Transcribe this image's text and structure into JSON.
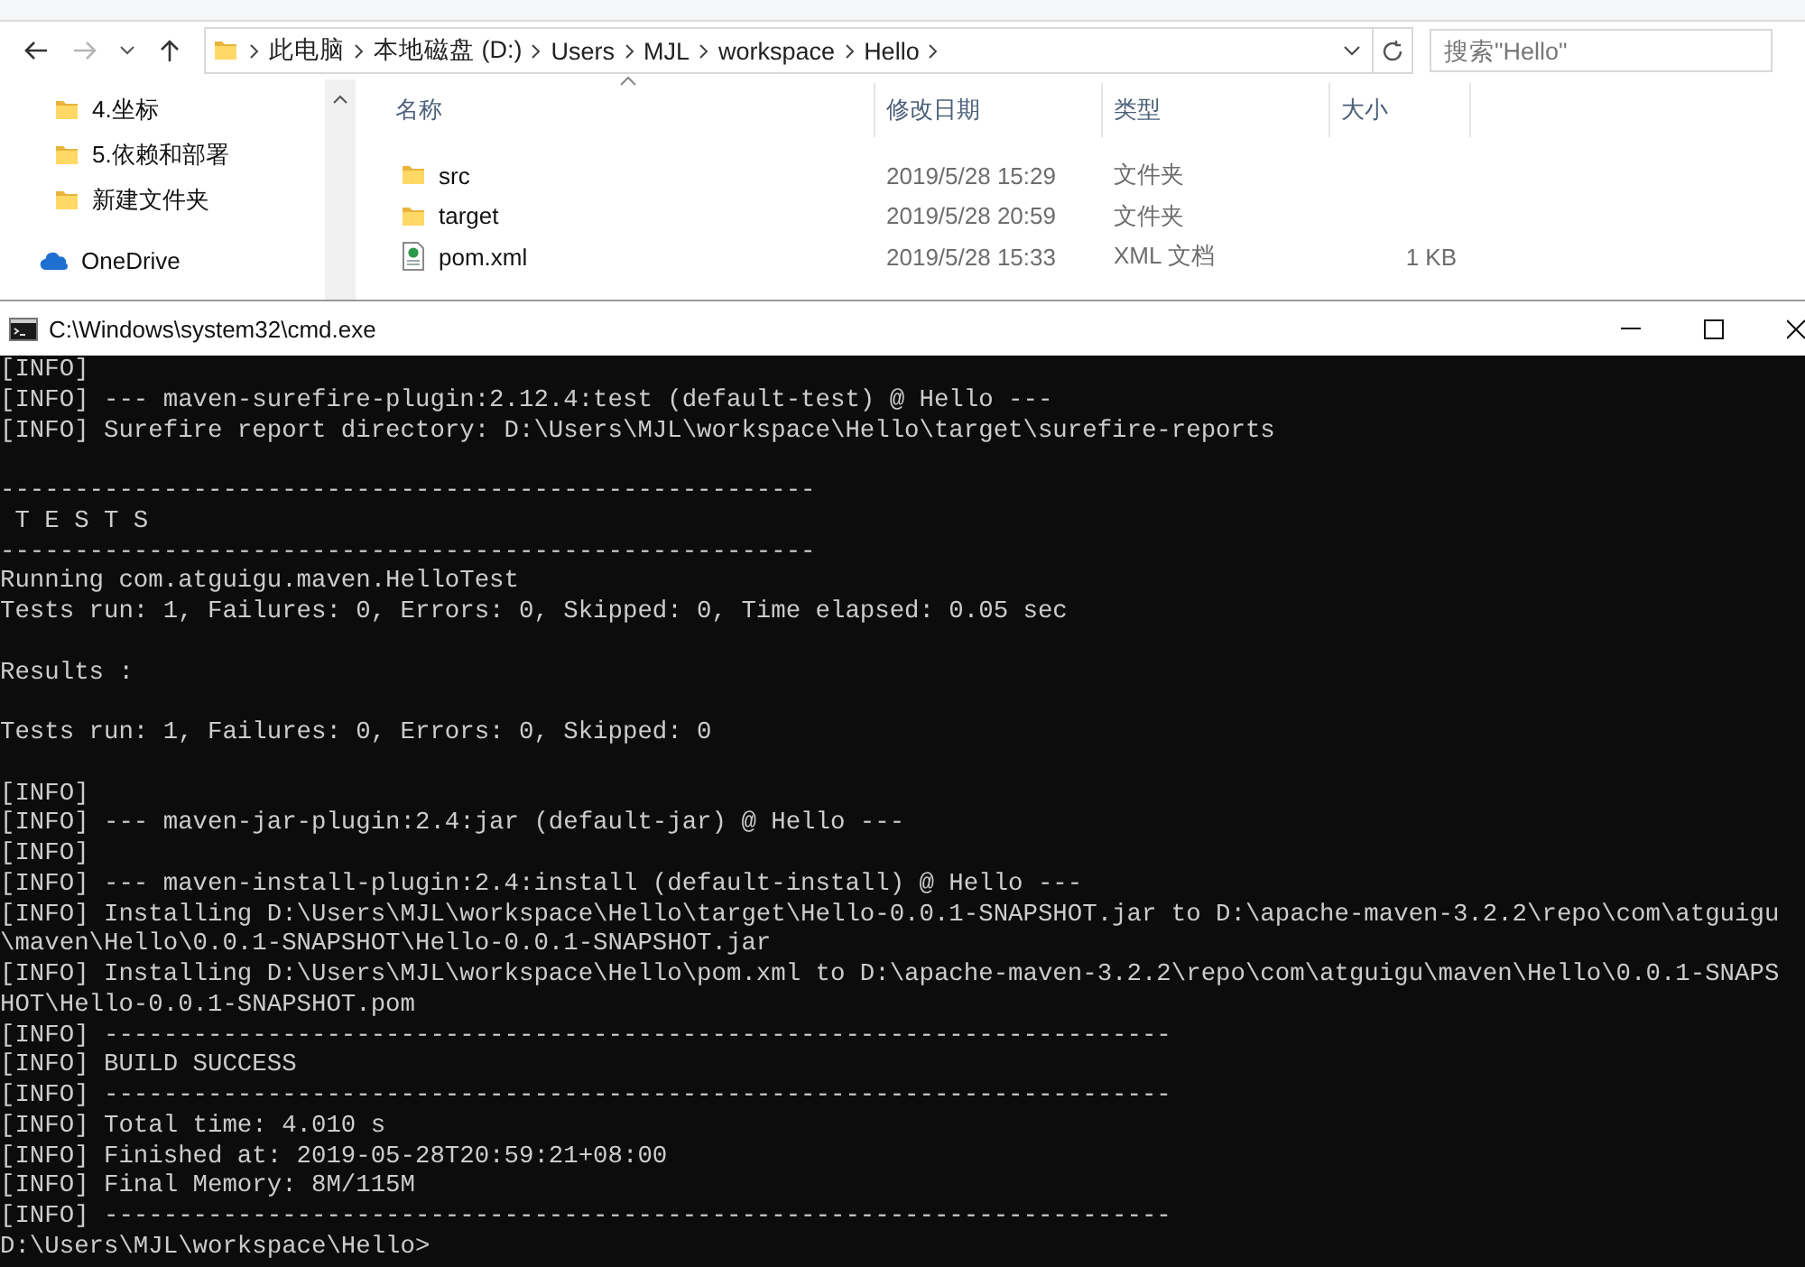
{
  "explorer": {
    "breadcrumbs": [
      "此电脑",
      "本地磁盘 (D:)",
      "Users",
      "MJL",
      "workspace",
      "Hello"
    ],
    "search": {
      "placeholder": "搜索\"Hello\""
    },
    "nav_pane": {
      "items": [
        {
          "kind": "folder",
          "label": "4.坐标"
        },
        {
          "kind": "folder",
          "label": "5.依赖和部署"
        },
        {
          "kind": "folder",
          "label": "新建文件夹"
        },
        {
          "kind": "cloud",
          "label": "OneDrive"
        }
      ]
    },
    "file_list": {
      "columns": [
        {
          "label": "名称",
          "sorted": true
        },
        {
          "label": "修改日期",
          "sorted": false
        },
        {
          "label": "类型",
          "sorted": false
        },
        {
          "label": "大小",
          "sorted": false
        }
      ],
      "rows": [
        {
          "kind": "folder",
          "name": "src",
          "modified": "2019/5/28 15:29",
          "type": "文件夹"
        },
        {
          "kind": "folder",
          "name": "target",
          "modified": "2019/5/28 20:59",
          "type": "文件夹"
        },
        {
          "kind": "xml",
          "name": "pom.xml",
          "modified": "2019/5/28 15:33",
          "type": "XML 文档",
          "size": "1 KB"
        }
      ]
    }
  },
  "cmd": {
    "title": "C:\\Windows\\system32\\cmd.exe",
    "lines": [
      {
        "kind": "text",
        "text": "[INFO]"
      },
      {
        "kind": "text",
        "text": "[INFO] --- maven-surefire-plugin:2.12.4:test (default-test) @ Hello ---"
      },
      {
        "kind": "text",
        "text": "[INFO] Surefire report directory: D:\\Users\\MJL\\workspace\\Hello\\target\\surefire-reports"
      },
      {
        "kind": "blank"
      },
      {
        "kind": "text",
        "text": "-------------------------------------------------------"
      },
      {
        "kind": "text",
        "text": " T E S T S"
      },
      {
        "kind": "text",
        "text": "-------------------------------------------------------"
      },
      {
        "kind": "text",
        "text": "Running com.atguigu.maven.HelloTest"
      },
      {
        "kind": "text",
        "text": "Tests run: 1, Failures: 0, Errors: 0, Skipped: 0, Time elapsed: 0.05 sec"
      },
      {
        "kind": "blank"
      },
      {
        "kind": "text",
        "text": "Results :"
      },
      {
        "kind": "blank"
      },
      {
        "kind": "text",
        "text": "Tests run: 1, Failures: 0, Errors: 0, Skipped: 0"
      },
      {
        "kind": "blank"
      },
      {
        "kind": "text",
        "text": "[INFO]"
      },
      {
        "kind": "text",
        "text": "[INFO] --- maven-jar-plugin:2.4:jar (default-jar) @ Hello ---"
      },
      {
        "kind": "text",
        "text": "[INFO]"
      },
      {
        "kind": "text",
        "text": "[INFO] --- maven-install-plugin:2.4:install (default-install) @ Hello ---"
      },
      {
        "kind": "text",
        "text": "[INFO] Installing D:\\Users\\MJL\\workspace\\Hello\\target\\Hello-0.0.1-SNAPSHOT.jar to D:\\apache-maven-3.2.2\\repo\\com\\atguigu"
      },
      {
        "kind": "text",
        "text": "\\maven\\Hello\\0.0.1-SNAPSHOT\\Hello-0.0.1-SNAPSHOT.jar"
      },
      {
        "kind": "text",
        "text": "[INFO] Installing D:\\Users\\MJL\\workspace\\Hello\\pom.xml to D:\\apache-maven-3.2.2\\repo\\com\\atguigu\\maven\\Hello\\0.0.1-SNAPS"
      },
      {
        "kind": "text",
        "text": "HOT\\Hello-0.0.1-SNAPSHOT.pom"
      },
      {
        "kind": "text",
        "text": "[INFO] ------------------------------------------------------------------------"
      },
      {
        "kind": "text",
        "text": "[INFO] BUILD SUCCESS"
      },
      {
        "kind": "text",
        "text": "[INFO] ------------------------------------------------------------------------"
      },
      {
        "kind": "text",
        "text": "[INFO] Total time: 4.010 s"
      },
      {
        "kind": "text",
        "text": "[INFO] Finished at: 2019-05-28T20:59:21+08:00"
      },
      {
        "kind": "text",
        "text": "[INFO] Final Memory: 8M/115M"
      },
      {
        "kind": "text",
        "text": "[INFO] ------------------------------------------------------------------------"
      },
      {
        "kind": "text",
        "text": "D:\\Users\\MJL\\workspace\\Hello>"
      }
    ]
  }
}
